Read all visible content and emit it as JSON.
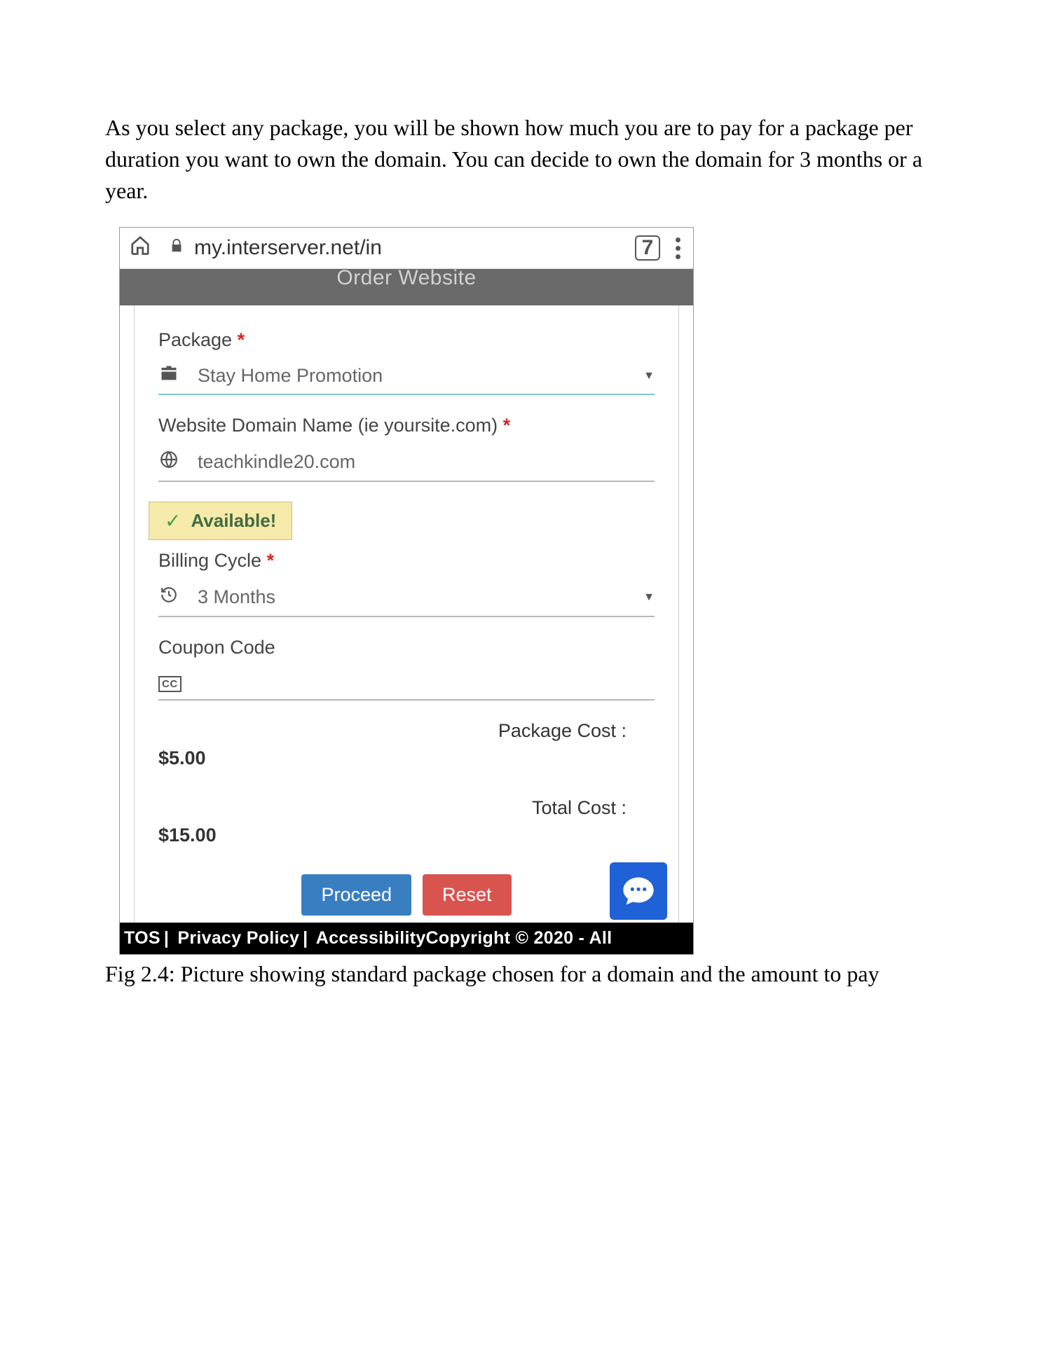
{
  "intro": "As you select any package, you will be shown how much you are to pay for a package per duration you want to own the domain. You can decide to own the domain for 3 months or a year.",
  "browser": {
    "url": "my.interserver.net/in",
    "tab_count": "7"
  },
  "page": {
    "header_title": "Order Website",
    "package": {
      "label": "Package",
      "value": "Stay Home Promotion"
    },
    "domain": {
      "label": "Website Domain Name (ie yoursite.com)",
      "value": "teachkindle20.com",
      "status": "Available!"
    },
    "billing": {
      "label": "Billing Cycle",
      "value": "3 Months"
    },
    "coupon": {
      "label": "Coupon Code",
      "value": ""
    },
    "costs": {
      "package_label": "Package Cost :",
      "package_value": "$5.00",
      "total_label": "Total Cost :",
      "total_value": "$15.00"
    },
    "buttons": {
      "proceed": "Proceed",
      "reset": "Reset"
    }
  },
  "footer": {
    "tos": "TOS",
    "privacy": "Privacy Policy",
    "accessibility": "Accessibility",
    "copyright": "Copyright © 2020 - All"
  },
  "caption": "Fig 2.4: Picture showing standard package chosen for a domain and the amount to pay"
}
